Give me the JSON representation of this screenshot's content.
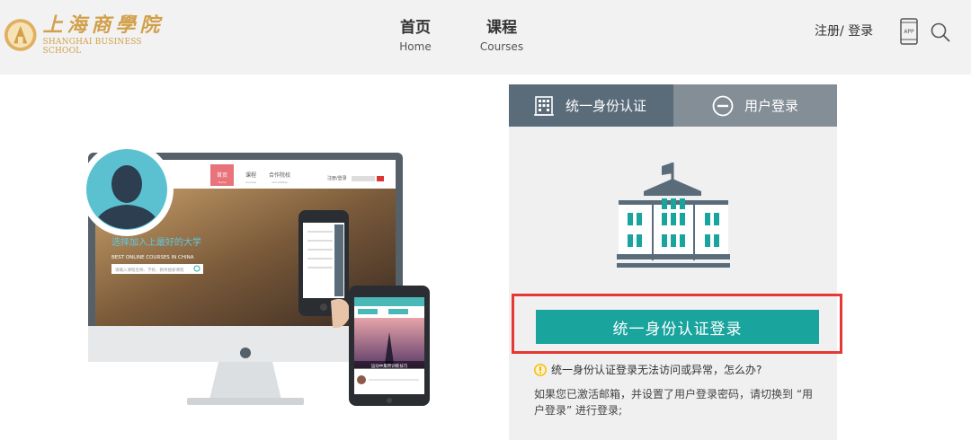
{
  "header": {
    "logo_cn": "上海商學院",
    "logo_en": "SHANGHAI BUSINESS SCHOOL",
    "nav": [
      {
        "cn": "首页",
        "en": "Home"
      },
      {
        "cn": "课程",
        "en": "Courses"
      }
    ],
    "register": "注册",
    "separator": "/ ",
    "login": "登录",
    "app_label": "APP",
    "icons": [
      "school-emblem-icon",
      "app-phone-icon",
      "search-icon"
    ],
    "brand_color": "#d2a04a"
  },
  "illustration": {
    "site_nav": [
      "首页",
      "课程",
      "合作院校"
    ],
    "site_nav_en": [
      "Home",
      "Courses",
      "Universities"
    ],
    "site_auth": "注册/登录",
    "hero_title": "选择加入上最好的大学",
    "hero_subtitle": "BEST ONLINE COURSES IN CHINA",
    "hero_search": "请输入课程名称、学校、教师搜索课程",
    "tablet_caption": "运动中集所训练技巧"
  },
  "panel": {
    "tabs": [
      {
        "label": "统一身份认证",
        "icon": "building-grid-icon",
        "active": true
      },
      {
        "label": "用户登录",
        "icon": "minus-circle-icon",
        "active": false
      }
    ],
    "sso_button": "统一身份认证登录",
    "help_question": "统一身份认证登录无法访问或异常，怎么办?",
    "help_text": "如果您已激活邮箱，并设置了用户登录密码，请切换到 “用户登录” 进行登录;",
    "colors": {
      "tab_active": "#5a6b7a",
      "tab_inactive": "#848e97",
      "button": "#1aa49e",
      "highlight": "#e53935",
      "warning": "#f5b800"
    }
  }
}
